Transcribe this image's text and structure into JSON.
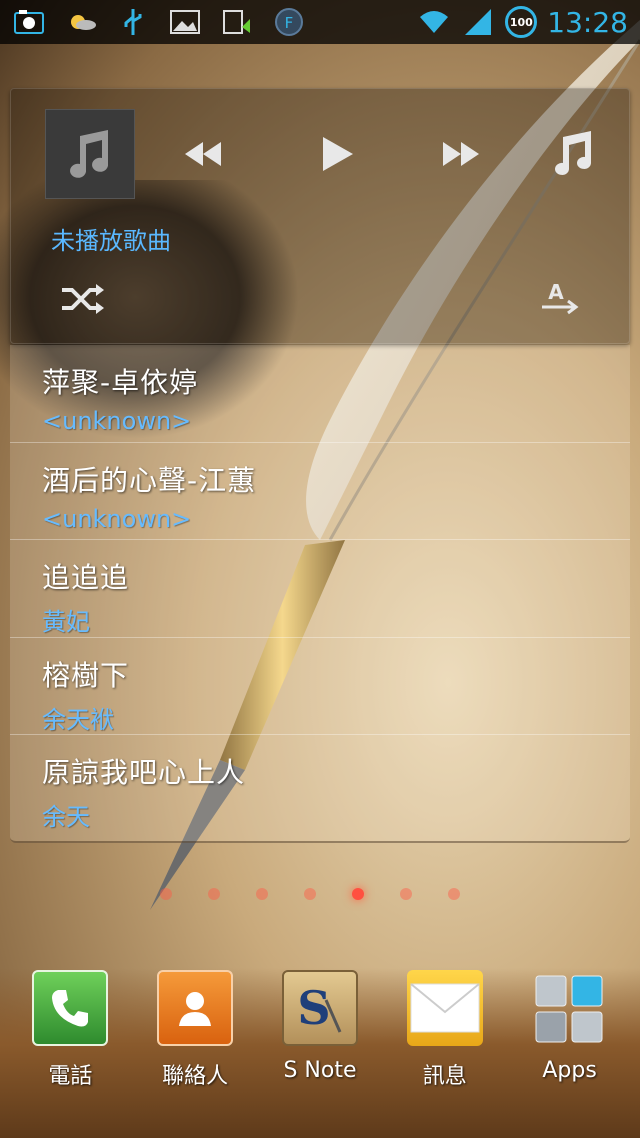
{
  "status_bar": {
    "time": "13:28",
    "battery": "100",
    "icons": [
      "screenshot-icon",
      "weather-icon",
      "usb-icon",
      "gallery-icon",
      "update-icon",
      "f-app-icon",
      "wifi-icon",
      "signal-icon",
      "battery-icon"
    ]
  },
  "music_widget": {
    "now_playing": "未播放歌曲",
    "controls": [
      "rewind-icon",
      "play-icon",
      "fast-forward-icon",
      "music-note-icon",
      "shuffle-icon",
      "text-direction-icon"
    ]
  },
  "songs": [
    {
      "title": "萍聚-卓依婷",
      "artist": "<unknown>"
    },
    {
      "title": "酒后的心聲-江蕙",
      "artist": "<unknown>"
    },
    {
      "title": "追追追",
      "artist": "黃妃"
    },
    {
      "title": "榕樹下",
      "artist": "余天袱"
    },
    {
      "title": "原諒我吧心上人",
      "artist": "余天"
    }
  ],
  "page_indicator": {
    "count": 7,
    "active": 4
  },
  "dock": [
    {
      "label": "電話",
      "icon": "phone-icon",
      "color": "#3aa94a"
    },
    {
      "label": "聯絡人",
      "icon": "contacts-icon",
      "color": "#e8731a"
    },
    {
      "label": "S Note",
      "icon": "snote-icon",
      "color": "#c9a86a"
    },
    {
      "label": "訊息",
      "icon": "messages-icon",
      "color": "#f4c02a"
    },
    {
      "label": "Apps",
      "icon": "apps-icon",
      "color": "#33b5e5"
    }
  ]
}
